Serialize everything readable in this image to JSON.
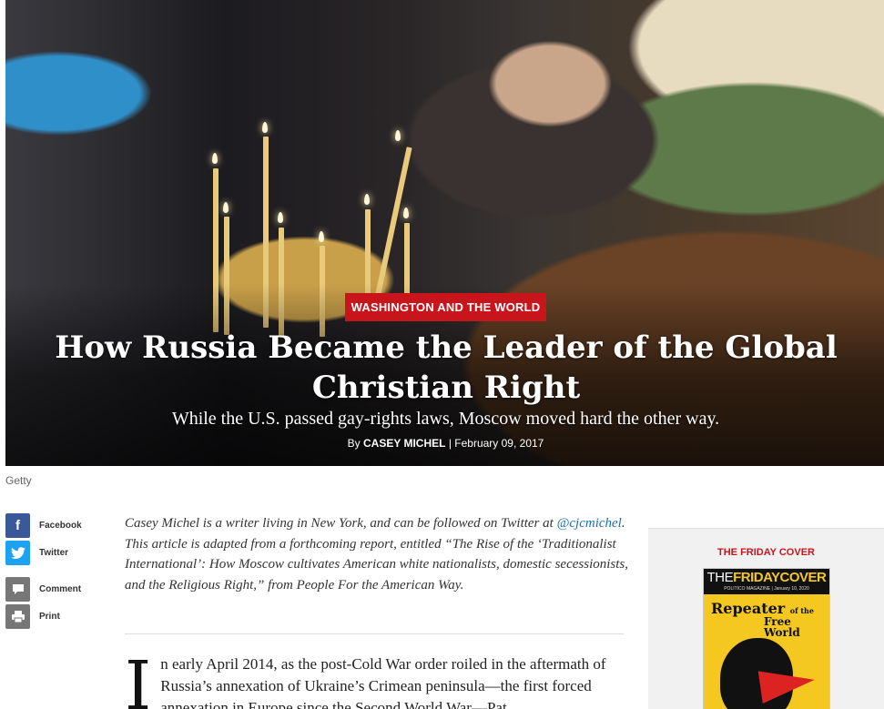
{
  "hero": {
    "kicker": "WASHINGTON AND THE WORLD",
    "headline_line1": "How Russia Became the Leader of the Global",
    "headline_line2": "Christian Right",
    "dek": "While the U.S. passed gay-rights laws, Moscow moved hard the other way.",
    "byline_prefix": "By",
    "author": "CASEY MICHEL",
    "date": "| February 09, 2017",
    "photo_credit": "Getty"
  },
  "share": {
    "facebook": "Facebook",
    "twitter": "Twitter",
    "comment": "Comment",
    "print": "Print",
    "icons": [
      "facebook-icon",
      "twitter-icon",
      "comment-icon",
      "print-icon"
    ]
  },
  "note": {
    "part1": "Casey Michel is a writer living in New York, and can be followed on Twitter at ",
    "handle": "@cjcmichel",
    "part2": ". This article is adapted from a forthcoming report, entitled “The Rise of the ‘Traditionalist International’: How Moscow cultivates American white nationalists, domestic secessionists, and the Religious Right,” from People For the American Way."
  },
  "article": {
    "dropcap": "I",
    "text": "n early April 2014, as the post-Cold War order roiled in the aftermath of Russia’s annexation of Ukraine’s Crimean peninsula—the first forced annexation in Europe since the Second World War—Pat"
  },
  "sidebar": {
    "title": "THE FRIDAY COVER",
    "cover_masthead_the": "THE",
    "cover_masthead_rest": "FRIDAYCOVER",
    "cover_sub": "POLITICO MAGAZINE | January 10, 2020",
    "cover_word": "Repeater",
    "cover_ofthe": "of the",
    "cover_free": "Free",
    "cover_world": "World"
  },
  "colors": {
    "accent_red": "#c8151b",
    "link_blue": "#1f6fb5",
    "facebook": "#3b5998",
    "twitter": "#1da1f2",
    "grey_icon": "#777777",
    "cover_yellow": "#f4c821"
  }
}
